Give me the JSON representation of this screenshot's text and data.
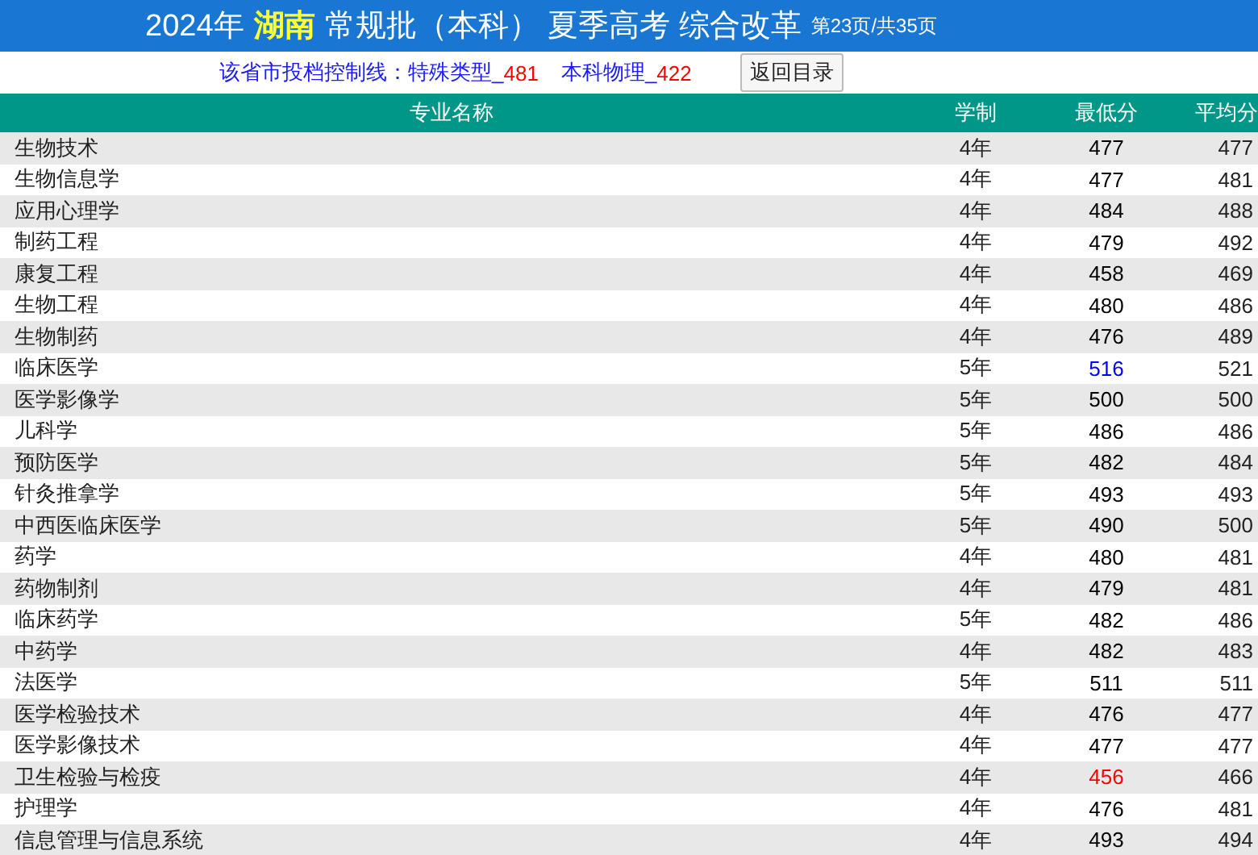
{
  "title": {
    "year": "2024年",
    "province": "湖南",
    "batch": "常规批（本科） 夏季高考 综合改革",
    "page": "第23页/共35页"
  },
  "control_lines": {
    "label": "该省市投档控制线：",
    "items": [
      {
        "name": "特殊类型_",
        "score": "481"
      },
      {
        "name": "本科物理_",
        "score": "422"
      }
    ]
  },
  "back_button": "返回目录",
  "table": {
    "columns": [
      "专业名称",
      "学制",
      "最低分",
      "平均分"
    ],
    "rows": [
      {
        "major": "生物技术",
        "years": "4年",
        "min": "477",
        "avg": "477",
        "color": "#000000"
      },
      {
        "major": "生物信息学",
        "years": "4年",
        "min": "477",
        "avg": "481",
        "color": "#000000"
      },
      {
        "major": "应用心理学",
        "years": "4年",
        "min": "484",
        "avg": "488",
        "color": "#000000"
      },
      {
        "major": "制药工程",
        "years": "4年",
        "min": "479",
        "avg": "492",
        "color": "#000000"
      },
      {
        "major": "康复工程",
        "years": "4年",
        "min": "458",
        "avg": "469",
        "color": "#000000"
      },
      {
        "major": "生物工程",
        "years": "4年",
        "min": "480",
        "avg": "486",
        "color": "#000000"
      },
      {
        "major": "生物制药",
        "years": "4年",
        "min": "476",
        "avg": "489",
        "color": "#000000"
      },
      {
        "major": "临床医学",
        "years": "5年",
        "min": "516",
        "avg": "521",
        "color": "#0000ff"
      },
      {
        "major": "医学影像学",
        "years": "5年",
        "min": "500",
        "avg": "500",
        "color": "#000000"
      },
      {
        "major": "儿科学",
        "years": "5年",
        "min": "486",
        "avg": "486",
        "color": "#000000"
      },
      {
        "major": "预防医学",
        "years": "5年",
        "min": "482",
        "avg": "484",
        "color": "#000000"
      },
      {
        "major": "针灸推拿学",
        "years": "5年",
        "min": "493",
        "avg": "493",
        "color": "#000000"
      },
      {
        "major": "中西医临床医学",
        "years": "5年",
        "min": "490",
        "avg": "500",
        "color": "#000000"
      },
      {
        "major": "药学",
        "years": "4年",
        "min": "480",
        "avg": "481",
        "color": "#000000"
      },
      {
        "major": "药物制剂",
        "years": "4年",
        "min": "479",
        "avg": "481",
        "color": "#000000"
      },
      {
        "major": "临床药学",
        "years": "5年",
        "min": "482",
        "avg": "486",
        "color": "#000000"
      },
      {
        "major": "中药学",
        "years": "4年",
        "min": "482",
        "avg": "483",
        "color": "#000000"
      },
      {
        "major": "法医学",
        "years": "5年",
        "min": "511",
        "avg": "511",
        "color": "#000000"
      },
      {
        "major": "医学检验技术",
        "years": "4年",
        "min": "476",
        "avg": "477",
        "color": "#000000"
      },
      {
        "major": "医学影像技术",
        "years": "4年",
        "min": "477",
        "avg": "477",
        "color": "#000000"
      },
      {
        "major": "卫生检验与检疫",
        "years": "4年",
        "min": "456",
        "avg": "466",
        "color": "#ff0000"
      },
      {
        "major": "护理学",
        "years": "4年",
        "min": "476",
        "avg": "481",
        "color": "#000000"
      },
      {
        "major": "信息管理与信息系统",
        "years": "4年",
        "min": "493",
        "avg": "494",
        "color": "#000000"
      }
    ]
  }
}
